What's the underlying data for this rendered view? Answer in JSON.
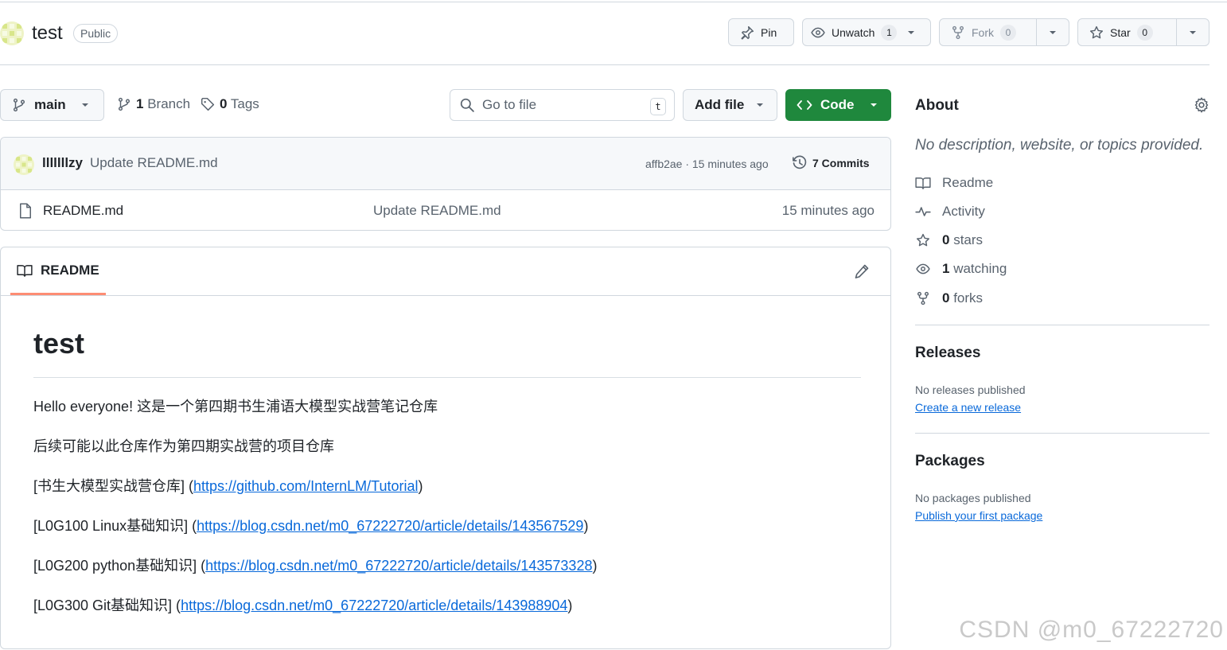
{
  "repo": {
    "name": "test",
    "visibility": "Public",
    "actions": {
      "pin_label": "Pin",
      "watch_label": "Unwatch",
      "watch_count": "1",
      "fork_label": "Fork",
      "fork_count": "0",
      "star_label": "Star",
      "star_count": "0"
    }
  },
  "toolbar": {
    "branch": "main",
    "branches_count": "1",
    "branches_label": "Branch",
    "tags_count": "0",
    "tags_label": "Tags",
    "go_to_file_placeholder": "Go to file",
    "go_to_file_shortcut": "t",
    "add_file_label": "Add file",
    "code_label": "Code"
  },
  "latest_commit": {
    "author": "lllllllzy",
    "message": "Update README.md",
    "meta": "affb2ae · 15 minutes ago",
    "commits_label": "7 Commits"
  },
  "files": [
    {
      "name": "README.md",
      "commit_message": "Update README.md",
      "time": "15 minutes ago"
    }
  ],
  "readme": {
    "tab_label": "README",
    "heading": "test",
    "paragraphs": [
      "Hello everyone! 这是一个第四期书生浦语大模型实战营笔记仓库",
      "后续可能以此仓库作为第四期实战营的项目仓库"
    ],
    "links": [
      {
        "prefix": "[书生大模型实战营仓库] (",
        "url": "https://github.com/InternLM/Tutorial",
        "suffix": ")"
      },
      {
        "prefix": "[L0G100 Linux基础知识] (",
        "url": "https://blog.csdn.net/m0_67222720/article/details/143567529",
        "suffix": ")"
      },
      {
        "prefix": "[L0G200 python基础知识] (",
        "url": "https://blog.csdn.net/m0_67222720/article/details/143573328",
        "suffix": ")"
      },
      {
        "prefix": "[L0G300 Git基础知识] (",
        "url": "https://blog.csdn.net/m0_67222720/article/details/143988904",
        "suffix": ")"
      }
    ]
  },
  "sidebar": {
    "about_title": "About",
    "about_description": "No description, website, or topics provided.",
    "stats": [
      {
        "icon": "book-icon",
        "bold": "",
        "label": "Readme"
      },
      {
        "icon": "pulse-icon",
        "bold": "",
        "label": "Activity"
      },
      {
        "icon": "star-icon",
        "bold": "0",
        "label": "stars"
      },
      {
        "icon": "eye-icon",
        "bold": "1",
        "label": "watching"
      },
      {
        "icon": "fork-icon",
        "bold": "0",
        "label": "forks"
      }
    ],
    "releases": {
      "title": "Releases",
      "empty_text": "No releases published",
      "link": "Create a new release"
    },
    "packages": {
      "title": "Packages",
      "empty_text": "No packages published",
      "link": "Publish your first package"
    }
  },
  "watermark": "CSDN @m0_67222720",
  "colors": {
    "primary_button": "#1f883d",
    "link": "#0969da",
    "border": "#d0d7de",
    "active_tab_underline": "#fd8c73"
  }
}
